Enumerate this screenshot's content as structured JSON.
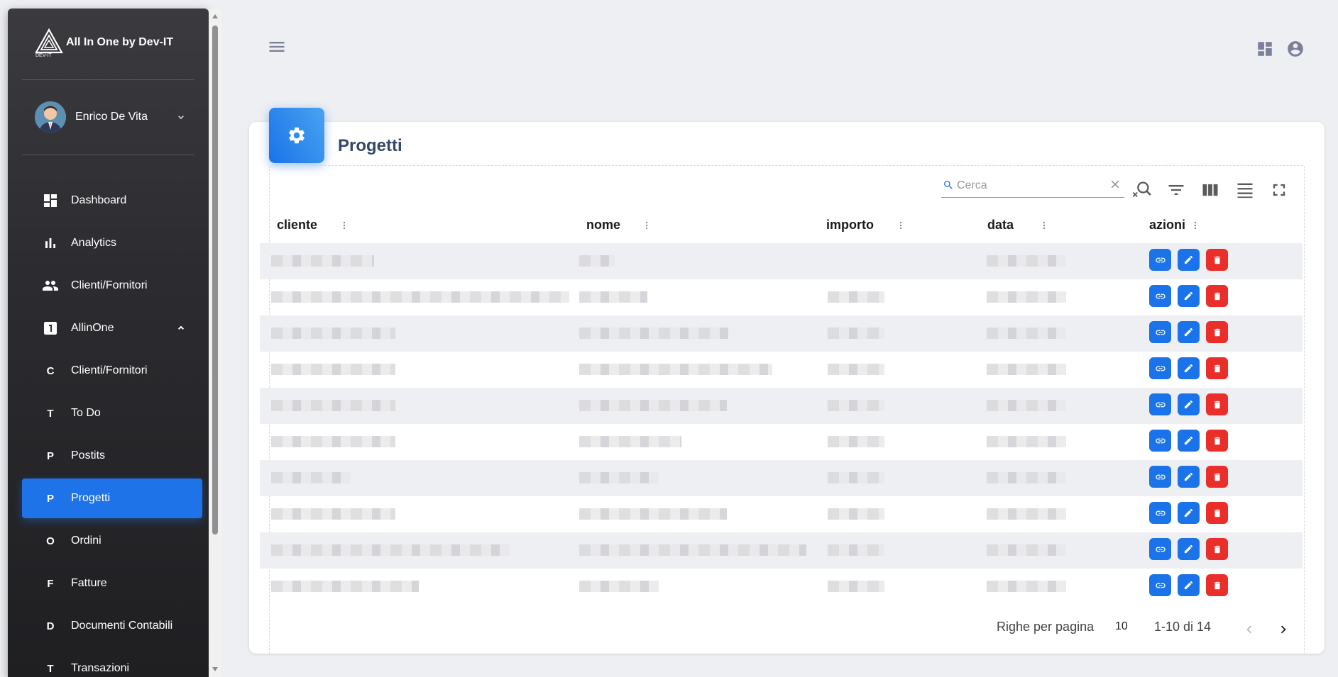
{
  "brand": {
    "title": "All In One by Dev-IT",
    "logo_text": "DEV-IT"
  },
  "user": {
    "name": "Enrico De Vita"
  },
  "nav": [
    {
      "label": "Dashboard",
      "icon": "dashboard-icon"
    },
    {
      "label": "Analytics",
      "icon": "bar-chart-icon"
    },
    {
      "label": "Clienti/Fornitori",
      "icon": "people-icon"
    },
    {
      "label": "AllinOne",
      "icon": "looks-one-icon",
      "expanded": true
    },
    {
      "label": "Clienti/Fornitori",
      "letter": "C"
    },
    {
      "label": "To Do",
      "letter": "T"
    },
    {
      "label": "Postits",
      "letter": "P"
    },
    {
      "label": "Progetti",
      "letter": "P",
      "active": true
    },
    {
      "label": "Ordini",
      "letter": "O"
    },
    {
      "label": "Fatture",
      "letter": "F"
    },
    {
      "label": "Documenti Contabili",
      "letter": "D"
    },
    {
      "label": "Transazioni",
      "letter": "T"
    }
  ],
  "page": {
    "title": "Progetti"
  },
  "search": {
    "placeholder": "Cerca",
    "value": ""
  },
  "columns": [
    "cliente",
    "nome",
    "importo",
    "data",
    "azioni"
  ],
  "rows_visible": 10,
  "footer": {
    "rows_per_page_label": "Righe per pagina",
    "rows_per_page_value": "10",
    "range": "1-10 di 14"
  },
  "colors": {
    "accent": "#1a73e8",
    "danger": "#ea2f2a",
    "sidebar": "#2c2c30",
    "background": "#eeeff2"
  }
}
